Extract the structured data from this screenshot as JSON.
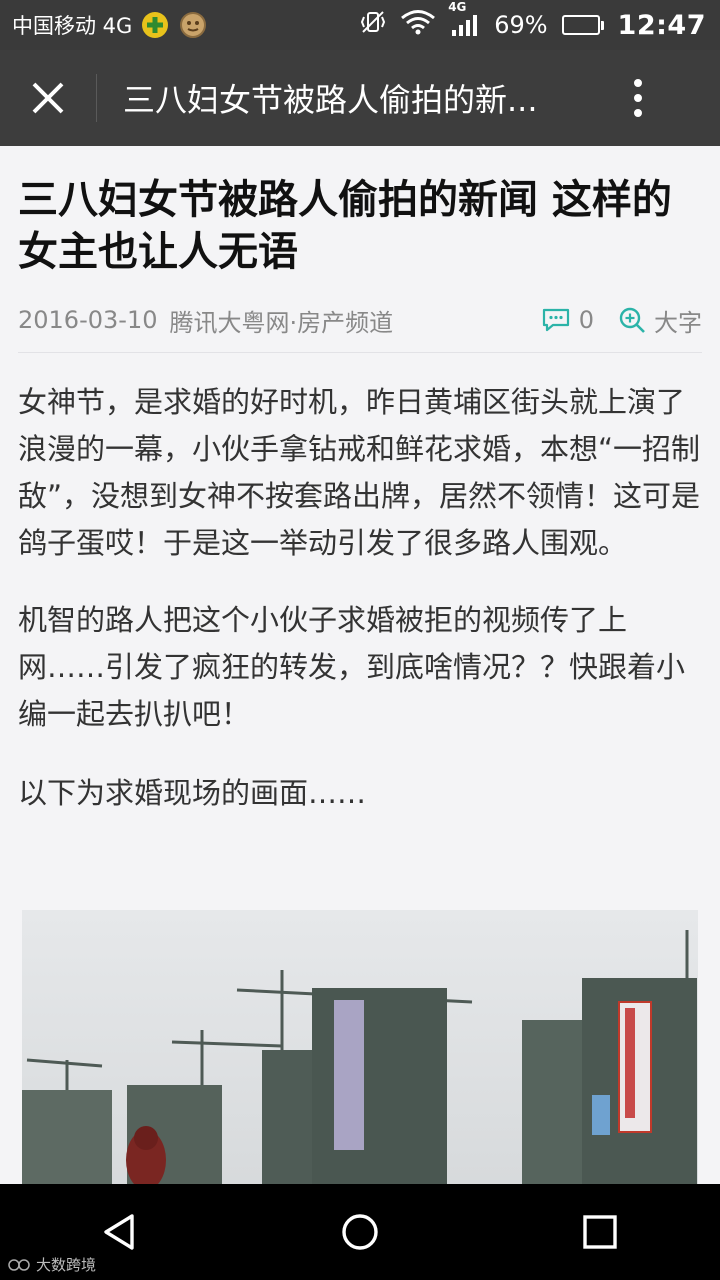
{
  "status_bar": {
    "carrier": "中国移动 4G",
    "net_small": "4G",
    "battery_text": "69%",
    "battery_level": 0.69,
    "time": "12:47"
  },
  "app_bar": {
    "title": "三八妇女节被路人偷拍的新..."
  },
  "article": {
    "title": "三八妇女节被路人偷拍的新闻 这样的女主也让人无语",
    "date": "2016-03-10",
    "source": "腾讯大粤网·房产频道",
    "comment_count": "0",
    "font_label": "大字",
    "paragraphs": [
      "女神节，是求婚的好时机，昨日黄埔区街头就上演了浪漫的一幕，小伙手拿钻戒和鲜花求婚，本想“一招制敌”，没想到女神不按套路出牌，居然不领情！这可是鸽子蛋哎！于是这一举动引发了很多路人围观。",
      "机智的路人把这个小伙子求婚被拒的视频传了上网……引发了疯狂的转发，到底啥情况？？快跟着小编一起去扒扒吧！",
      "以下为求婚现场的画面……"
    ]
  },
  "watermark": {
    "text": "大数跨境"
  },
  "colors": {
    "status_bg": "#3a3a3a",
    "appbar_bg": "#3d3d3d",
    "accent_teal": "#2bb3a8"
  }
}
